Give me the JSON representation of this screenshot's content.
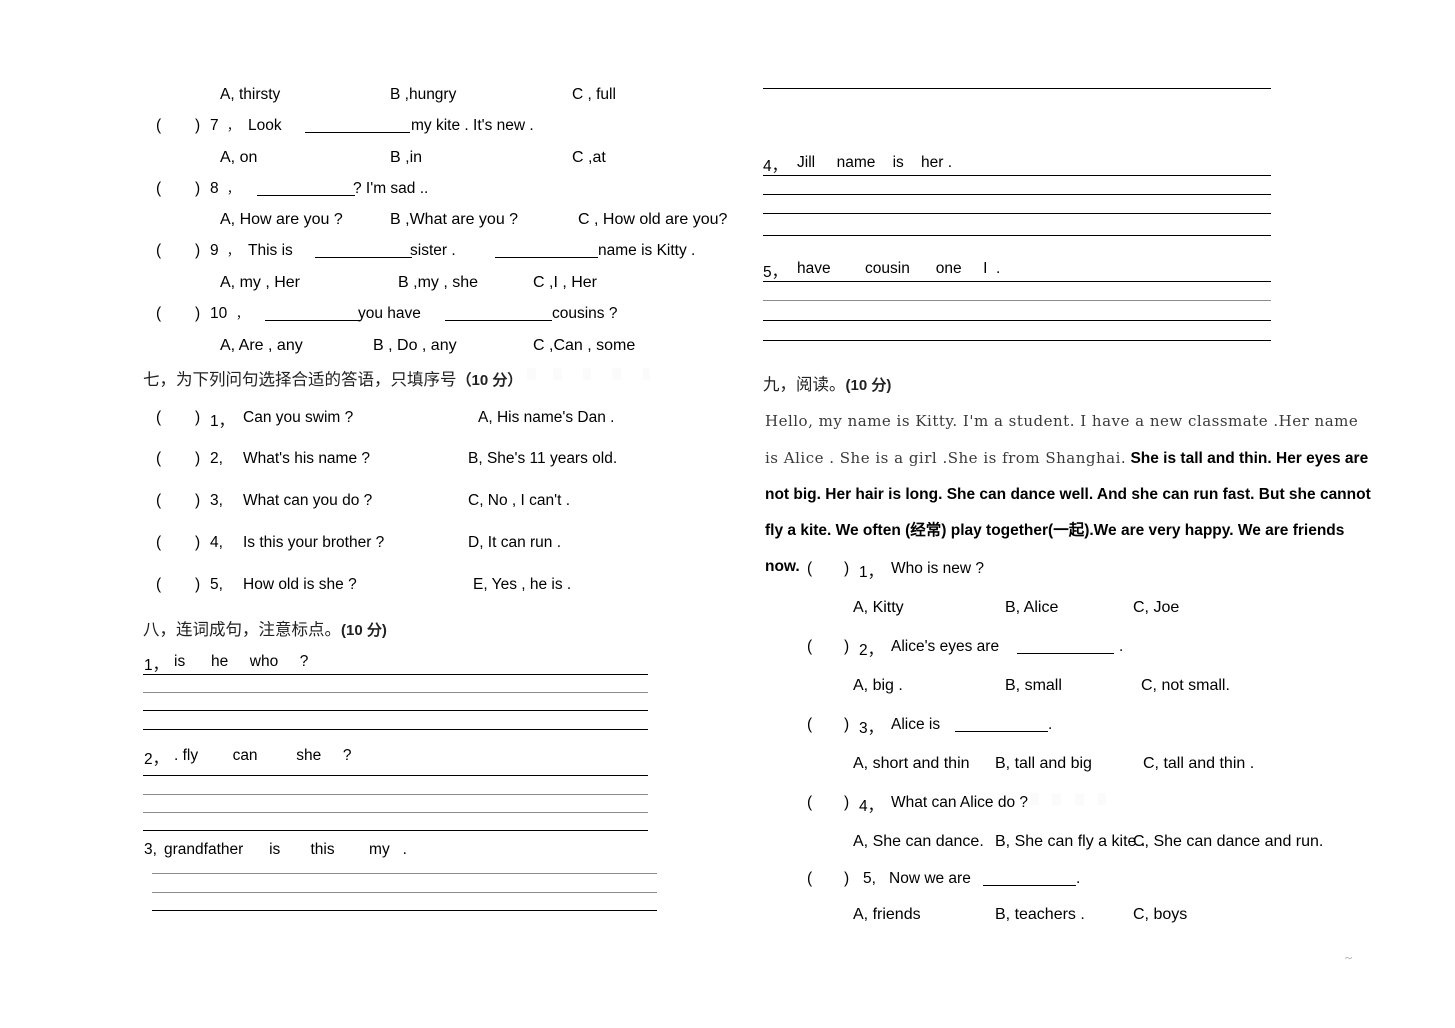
{
  "document": {
    "type": "english-exam-worksheet",
    "page_corner_mark": "~"
  },
  "left_column": {
    "carryover_options": {
      "a": "A, thirsty",
      "b": "B ,hungry",
      "c": "C , full"
    },
    "multiple_choice": [
      {
        "paren": "(",
        "paren_close": ")",
        "number": "7",
        "comma": "，",
        "stem_before": "Look",
        "stem_after": "my kite .   It's new .",
        "options": {
          "a": "A, on",
          "b": "B ,in",
          "c": "C ,at"
        }
      },
      {
        "paren": "(",
        "paren_close": ")",
        "number": "8",
        "comma": "，",
        "stem_before": "",
        "stem_after": "? I'm sad ..",
        "options": {
          "a": "A, How are you ?",
          "b": "B ,What are you ?",
          "c": "C , How old are you?"
        }
      },
      {
        "paren": "(",
        "paren_close": ")",
        "number": "9",
        "comma": "，",
        "stem_before": "This is",
        "stem_mid": "sister .",
        "stem_after": "name is Kitty .",
        "options": {
          "a": "A, my , Her",
          "b": "B ,my , she",
          "c": "C ,I , Her"
        }
      },
      {
        "paren": "(",
        "paren_close": ")",
        "number": "10",
        "comma": "，",
        "stem_before": "",
        "stem_mid": "you have",
        "stem_after": "cousins ?",
        "options": {
          "a": "A, Are , any",
          "b": "B , Do , any",
          "c": "C ,Can , some"
        }
      }
    ],
    "section_seven": {
      "heading": "七，为下列问句选择合适的答语，只填序号",
      "score": "（10 分）",
      "questions": [
        {
          "paren": "(",
          "paren_close": ")",
          "number": "1，",
          "text": "Can you swim ?",
          "answer": "A, His name's Dan ."
        },
        {
          "paren": "(",
          "paren_close": ")",
          "number": "2,",
          "text": "What's his name ?",
          "answer": "B, She's 11 years old."
        },
        {
          "paren": "(",
          "paren_close": ")",
          "number": "3,",
          "text": "What can you do ?",
          "answer": "C, No , I can't ."
        },
        {
          "paren": "(",
          "paren_close": ")",
          "number": "4,",
          "text": "Is this your brother ?",
          "answer": "D, It can run ."
        },
        {
          "paren": "(",
          "paren_close": ")",
          "number": "5,",
          "text": "How old is she ?",
          "answer": "E, Yes , he is ."
        }
      ]
    },
    "section_eight": {
      "heading": "八，连词成句，注意标点。",
      "score": "(10 分)",
      "items": [
        {
          "number": "1，",
          "words": "is      he     who     ?"
        },
        {
          "number": "2，",
          "words": ". fly        can         she     ?"
        },
        {
          "number": "3,",
          "words": "grandfather      is       this        my   ."
        }
      ]
    }
  },
  "right_column": {
    "section_eight_continued": {
      "items": [
        {
          "number": "4，",
          "words": "Jill     name    is    her ."
        },
        {
          "number": "5，",
          "words": "have        cousin      one     I  ."
        }
      ]
    },
    "section_nine": {
      "heading": "九，阅读。",
      "score": "(10 分)",
      "passage_serif": "Hello, my name is Kitty. I'm a student. I have a new classmate .Her name is Alice . She is a girl .She is from Shanghai.",
      "passage_sans": " She is tall and thin. Her eyes are not big. Her hair is long. She can dance well. And she can run fast. But she cannot fly a kite. We often (经常) play together(一起).We are very happy. We are friends now.",
      "questions": [
        {
          "paren": "(",
          "paren_close": ")",
          "number": "1，",
          "stem": "Who is new ?",
          "options": {
            "a": "A, Kitty",
            "b": "B, Alice",
            "c": "C, Joe"
          }
        },
        {
          "paren": "(",
          "paren_close": ")",
          "number": "2，",
          "stem_before": "Alice's eyes are",
          "stem_after": ".",
          "options": {
            "a": "A, big .",
            "b": "B, small",
            "c": "C, not small."
          }
        },
        {
          "paren": "(",
          "paren_close": ")",
          "number": "3，",
          "stem_before": "Alice is",
          "stem_after": ".",
          "options": {
            "a": "A, short and thin",
            "b": "B, tall and big",
            "c": "C, tall and thin ."
          }
        },
        {
          "paren": "(",
          "paren_close": ")",
          "number": "4，",
          "stem": "What can Alice do ?",
          "options": {
            "a": "A, She can dance.",
            "b": "B, She can fly a kite .",
            "c": "C, She can dance and run."
          }
        },
        {
          "paren": "(",
          "paren_close": ")",
          "number": "5,",
          "stem_before": "Now we are",
          "stem_after": ".",
          "options": {
            "a": "A, friends",
            "b": "B, teachers .",
            "c": "C, boys"
          }
        }
      ]
    }
  }
}
